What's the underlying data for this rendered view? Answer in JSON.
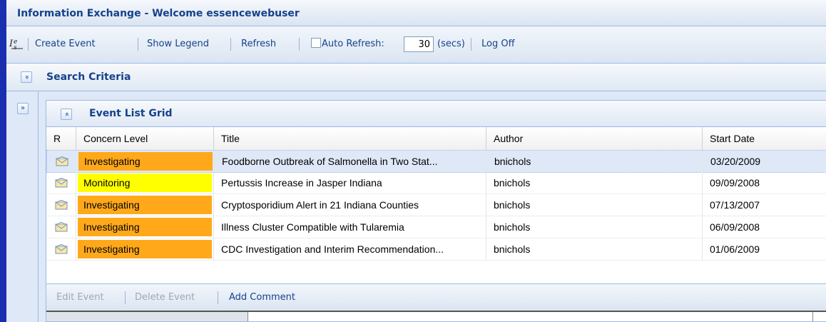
{
  "window": {
    "title": "Information Exchange - Welcome essencewebuser"
  },
  "toolbar": {
    "logo_icon": "essence-logo-icon",
    "create_event": "Create Event",
    "show_legend": "Show Legend",
    "refresh": "Refresh",
    "auto_refresh_label": "Auto Refresh:",
    "auto_refresh_value": "30",
    "auto_refresh_unit": "(secs)",
    "log_off": "Log Off"
  },
  "search": {
    "title": "Search Criteria",
    "toggle": "»"
  },
  "side": {
    "expand": "»"
  },
  "event_grid": {
    "title": "Event List Grid",
    "toggle": "«",
    "columns": {
      "r": "R",
      "concern": "Concern Level",
      "title": "Title",
      "author": "Author",
      "start": "Start Date"
    },
    "rows": [
      {
        "concern": "Investigating",
        "title": "Foodborne Outbreak of Salmonella in Two Stat...",
        "author": "bnichols",
        "start": "03/20/2009"
      },
      {
        "concern": "Monitoring",
        "title": "Pertussis Increase in Jasper Indiana",
        "author": "bnichols",
        "start": "09/09/2008"
      },
      {
        "concern": "Investigating",
        "title": "Cryptosporidium Alert in 21 Indiana Counties",
        "author": "bnichols",
        "start": "07/13/2007"
      },
      {
        "concern": "Investigating",
        "title": "Illness Cluster Compatible with Tularemia",
        "author": "bnichols",
        "start": "06/09/2008"
      },
      {
        "concern": "Investigating",
        "title": "CDC Investigation and Interim Recommendation...",
        "author": "bnichols",
        "start": "01/06/2009"
      }
    ]
  },
  "footer": {
    "edit_event": "Edit Event",
    "delete_event": "Delete Event",
    "add_comment": "Add Comment"
  },
  "colors": {
    "investigating": "#ffa91a",
    "monitoring": "#ffff00",
    "accent": "#15428b"
  }
}
